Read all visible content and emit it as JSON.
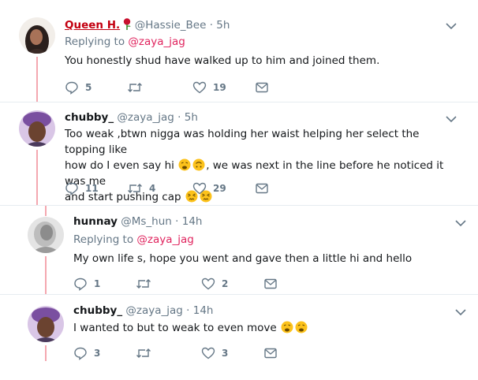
{
  "tweets": [
    {
      "display_name": "Queen H.",
      "handle": "@Hassie_Bee",
      "time": "· 5h",
      "replying_prefix": "Replying to",
      "replying_to": "@zaya_jag",
      "text": "You honestly shud have walked up to him and joined them.",
      "replies": "5",
      "retweets": "",
      "likes": "19"
    },
    {
      "display_name": "chubby_",
      "handle": "@zaya_jag",
      "time": "· 5h",
      "text_l1": "Too weak ,btwn nigga was holding her waist helping her select the topping like",
      "text_l2a": "how do I even say hi",
      "text_l2b": ", we was next in the line before he noticed it was me",
      "text_l3": "and start pushing cap",
      "replies": "11",
      "retweets": "4",
      "likes": "29"
    },
    {
      "display_name": "hunnay",
      "handle": "@Ms_hun",
      "time": "· 14h",
      "replying_prefix": "Replying to",
      "replying_to": "@zaya_jag",
      "text": "My own life s, hope you went and gave then a little hi and hello",
      "replies": "1",
      "retweets": "",
      "likes": "2"
    },
    {
      "display_name": "chubby_",
      "handle": "@zaya_jag",
      "time": "· 14h",
      "text": "I wanted to but to weak to even move",
      "replies": "3",
      "retweets": "",
      "likes": "3"
    }
  ],
  "colors": {
    "mention": "#e0245e",
    "thread_line": "#f4a8b0",
    "muted": "#657786",
    "separator": "#e6ecf0"
  },
  "icons": [
    "reply-icon",
    "retweet-icon",
    "like-icon",
    "dm-icon",
    "caret-down-icon",
    "rose-emoji",
    "weary-face-emoji",
    "upside-down-face-emoji",
    "persevering-face-emoji"
  ]
}
